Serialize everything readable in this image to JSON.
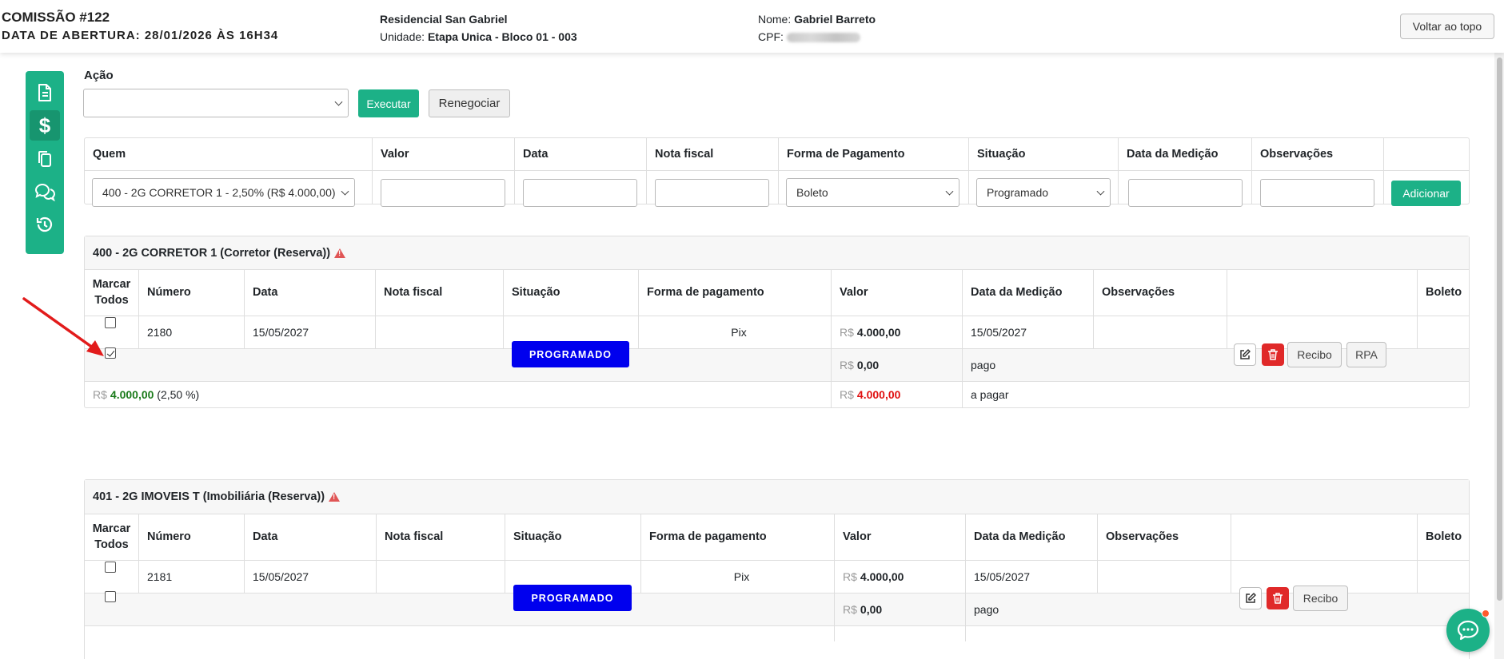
{
  "header": {
    "title": "COMISSÃO #122",
    "opened_label": "DATA DE ABERTURA: 28/01/2026 ÀS 16H34",
    "project": "Residencial San Gabriel",
    "unit_label": "Unidade:",
    "unit_value": "Etapa Unica - Bloco 01 - 003",
    "name_label": "Nome:",
    "name_value": "Gabriel Barreto",
    "cpf_label": "CPF:",
    "back_to_top": "Voltar ao topo"
  },
  "sidebar": {
    "items": [
      {
        "icon": "document-icon"
      },
      {
        "icon": "dollar-icon",
        "glyph": "$"
      },
      {
        "icon": "copy-icon"
      },
      {
        "icon": "chat-icon"
      },
      {
        "icon": "history-icon"
      }
    ]
  },
  "action": {
    "label": "Ação",
    "selected": "",
    "execute": "Executar",
    "renegotiate": "Renegociar"
  },
  "add_form": {
    "headers": [
      "Quem",
      "Valor",
      "Data",
      "Nota fiscal",
      "Forma de Pagamento",
      "Situação",
      "Data da Medição",
      "Observações"
    ],
    "quem_selected": "400 - 2G CORRETOR 1 - 2,50% (R$ 4.000,00)",
    "forma_selected": "Boleto",
    "situacao_selected": "Programado",
    "add_button": "Adicionar"
  },
  "sections": [
    {
      "title": "400 - 2G CORRETOR 1 (Corretor (Reserva))",
      "columns": {
        "mark_all_1": "Marcar",
        "mark_all_2": "Todos",
        "numero": "Número",
        "data": "Data",
        "nota": "Nota fiscal",
        "situacao": "Situação",
        "forma": "Forma de pagamento",
        "valor": "Valor",
        "medicao": "Data da Medição",
        "obs": "Observações",
        "boleto": "Boleto"
      },
      "row": {
        "checked": true,
        "numero": "2180",
        "data": "15/05/2027",
        "nota": "",
        "situacao": "PROGRAMADO",
        "forma": "Pix",
        "valor_prefix": "R$",
        "valor": "4.000,00",
        "medicao": "15/05/2027",
        "obs": "",
        "recibo": "Recibo",
        "rpa": "RPA"
      },
      "paid": {
        "prefix": "R$",
        "value": "0,00",
        "label": "pago"
      },
      "total": {
        "prefix": "R$",
        "value": "4.000,00",
        "pct": "(2,50 %)",
        "due_prefix": "R$",
        "due_value": "4.000,00",
        "due_label": "a pagar"
      }
    },
    {
      "title": "401 - 2G IMOVEIS T (Imobiliária (Reserva))",
      "columns": {
        "mark_all_1": "Marcar",
        "mark_all_2": "Todos",
        "numero": "Número",
        "data": "Data",
        "nota": "Nota fiscal",
        "situacao": "Situação",
        "forma": "Forma de pagamento",
        "valor": "Valor",
        "medicao": "Data da Medição",
        "obs": "Observações",
        "boleto": "Boleto"
      },
      "row": {
        "checked": false,
        "numero": "2181",
        "data": "15/05/2027",
        "nota": "",
        "situacao": "PROGRAMADO",
        "forma": "Pix",
        "valor_prefix": "R$",
        "valor": "4.000,00",
        "medicao": "15/05/2027",
        "obs": "",
        "recibo": "Recibo"
      },
      "paid": {
        "prefix": "R$",
        "value": "0,00",
        "label": "pago"
      }
    }
  ],
  "colors": {
    "brand": "#1cb187",
    "status_blue": "#0000ee",
    "danger": "#e02929",
    "positive": "#1a7a1a",
    "negative": "#e01010"
  }
}
